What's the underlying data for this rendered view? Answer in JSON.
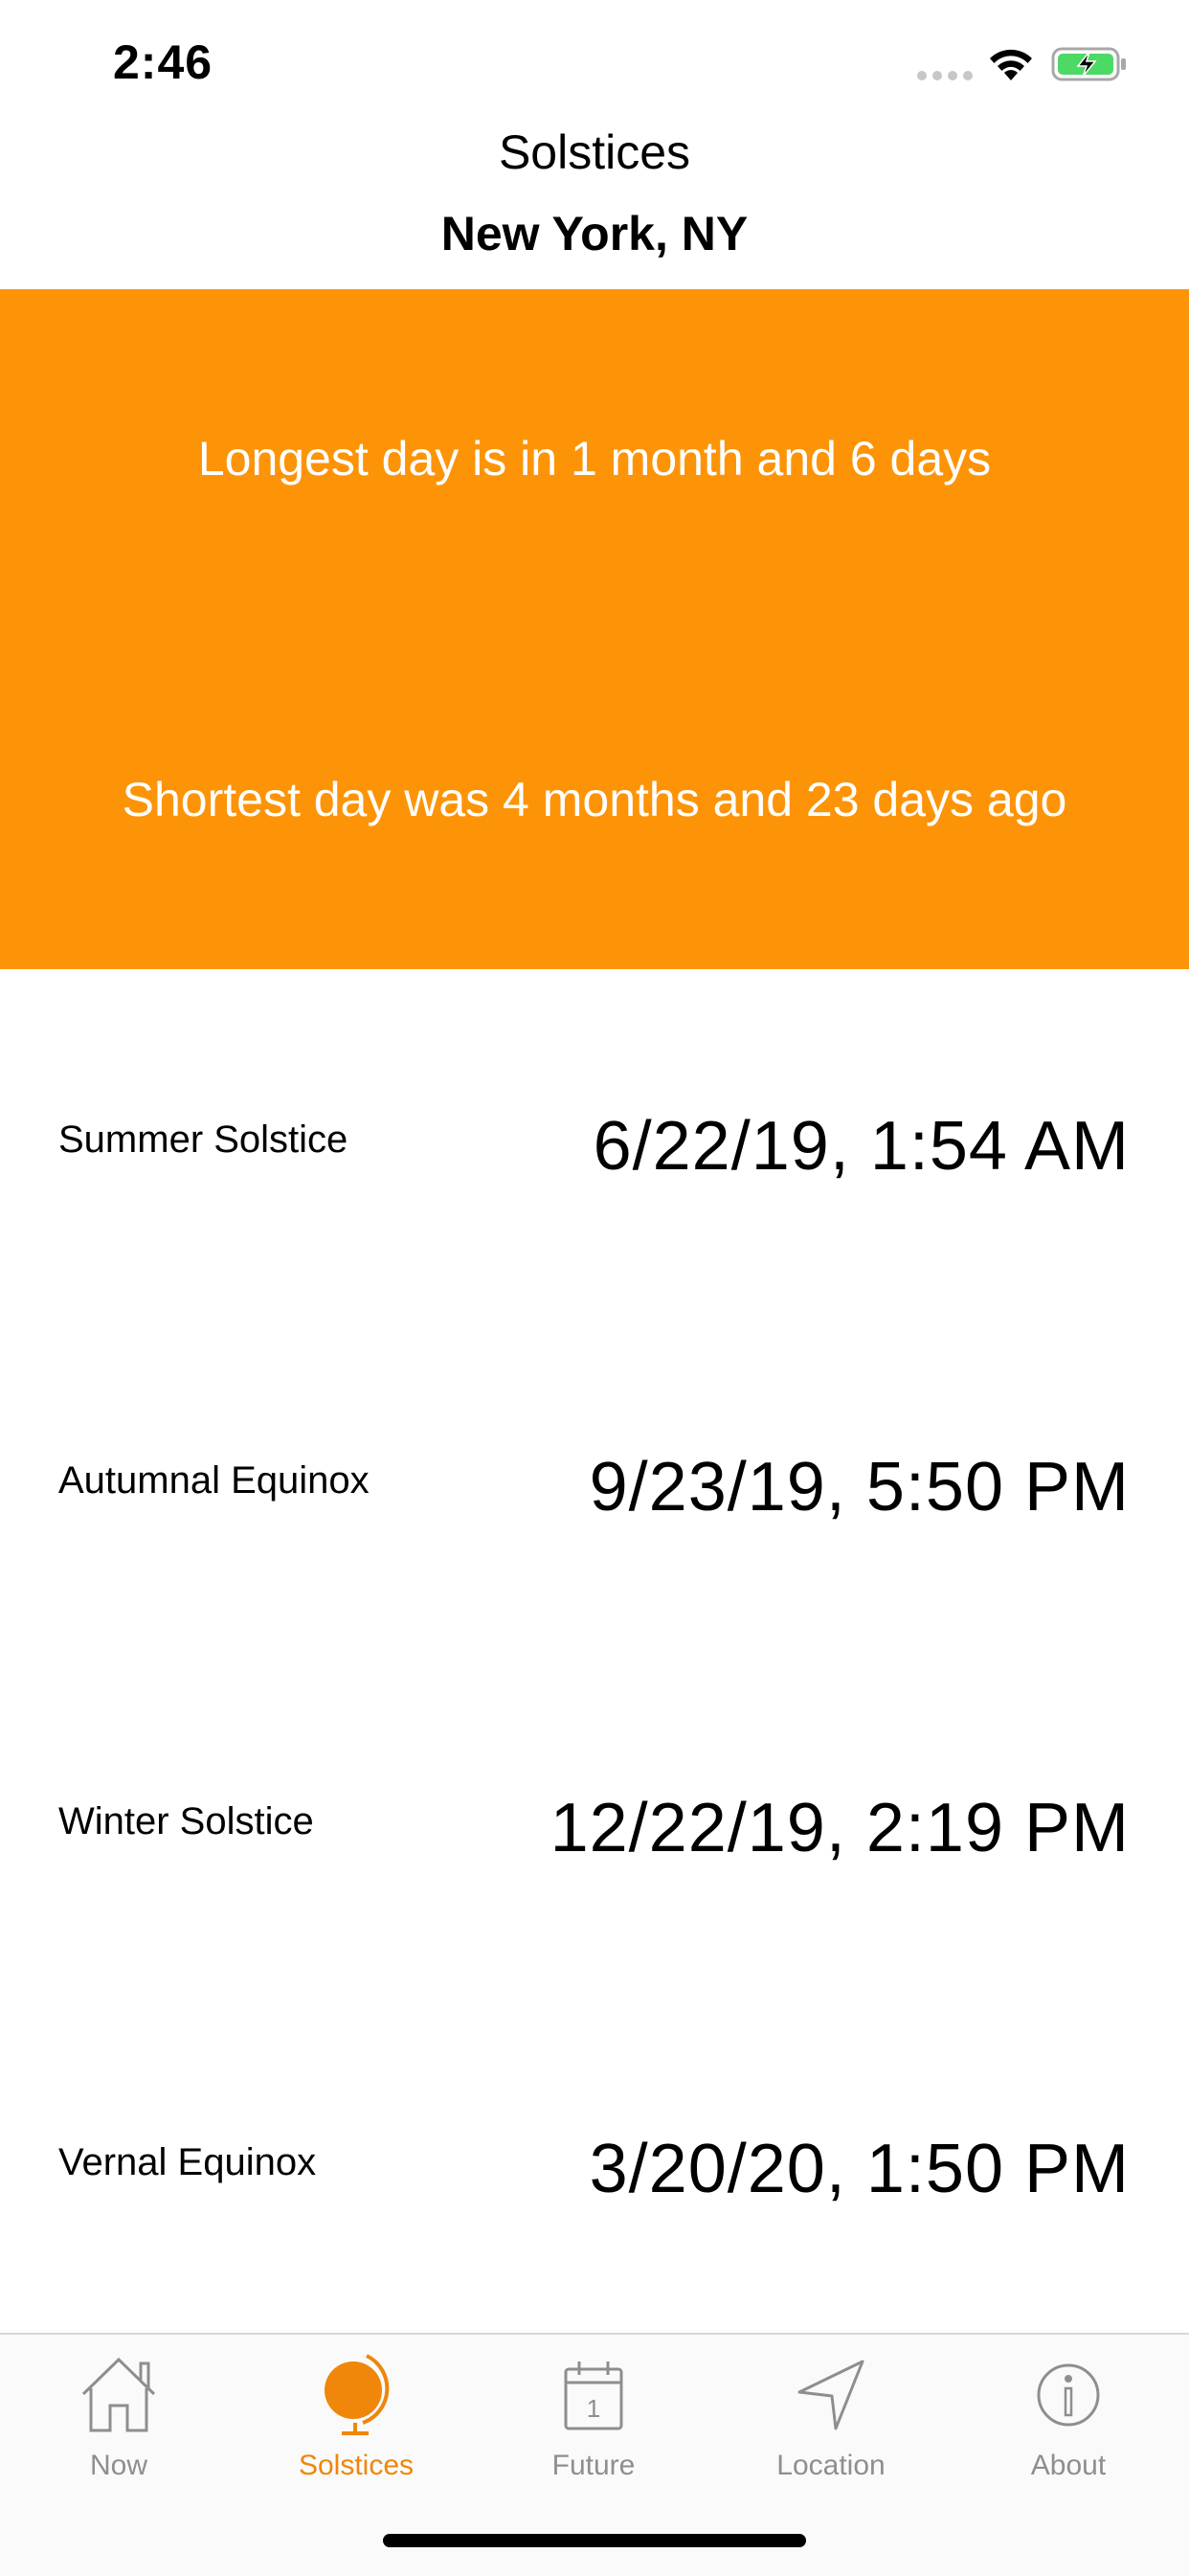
{
  "status_bar": {
    "time": "2:46",
    "battery_color": "#4cd964"
  },
  "header": {
    "title": "Solstices",
    "subtitle": "New York, NY"
  },
  "banner": {
    "color": "#fd9408",
    "longest_day_text": "Longest day is in 1 month and 6 days",
    "shortest_day_text": "Shortest day was 4 months and 23 days ago"
  },
  "events": [
    {
      "name": "Summer Solstice",
      "date": "6/22/19, 1:54 AM"
    },
    {
      "name": "Autumnal Equinox",
      "date": "9/23/19, 5:50 PM"
    },
    {
      "name": "Winter Solstice",
      "date": "12/22/19, 2:19 PM"
    },
    {
      "name": "Vernal Equinox",
      "date": "3/20/20, 1:50 PM"
    }
  ],
  "tab_bar": {
    "active_tab": "Solstices",
    "accent_color": "#f0860a",
    "inactive_color": "#8e8e8e",
    "tabs": [
      {
        "label": "Now",
        "icon": "house-icon"
      },
      {
        "label": "Solstices",
        "icon": "globe-icon"
      },
      {
        "label": "Future",
        "icon": "calendar-icon"
      },
      {
        "label": "Location",
        "icon": "location-arrow-icon"
      },
      {
        "label": "About",
        "icon": "info-icon"
      }
    ],
    "future_icon_day": "1"
  }
}
